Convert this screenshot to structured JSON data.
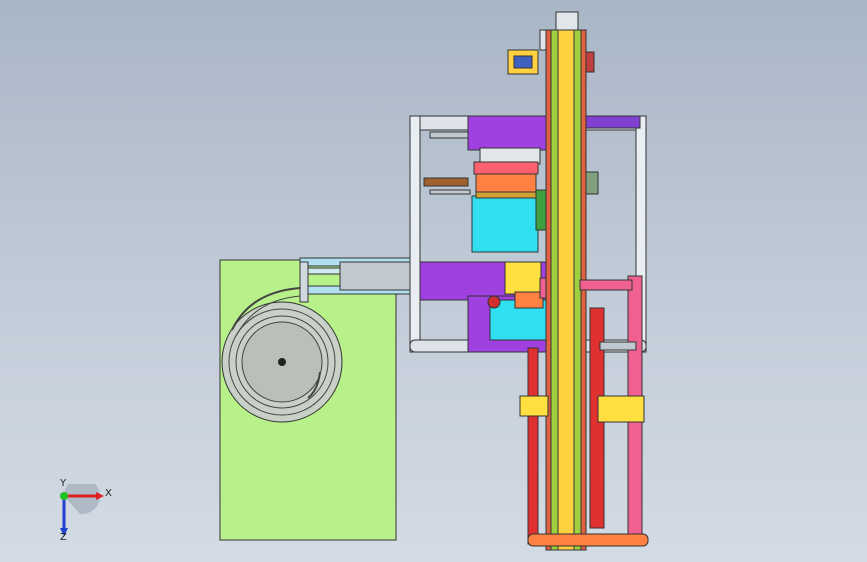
{
  "viewport": {
    "background_top": "#a9b6c6",
    "background_bottom": "#d3dbe4"
  },
  "triad": {
    "x_label": "X",
    "y_label": "Y",
    "z_label": "Z",
    "x_color": "#e02020",
    "y_color": "#20c020",
    "z_color": "#2040d0"
  },
  "colors": {
    "feeder_base": "#b8f08a",
    "frame": "#a8b0b8",
    "purple": "#a040e0",
    "cyan": "#30e0f0",
    "orange": "#ff8040",
    "yellow": "#ffe040",
    "green": "#40c040",
    "red": "#e03030",
    "pink": "#f06090"
  },
  "icons": {
    "origin": "origin-triad-icon"
  }
}
